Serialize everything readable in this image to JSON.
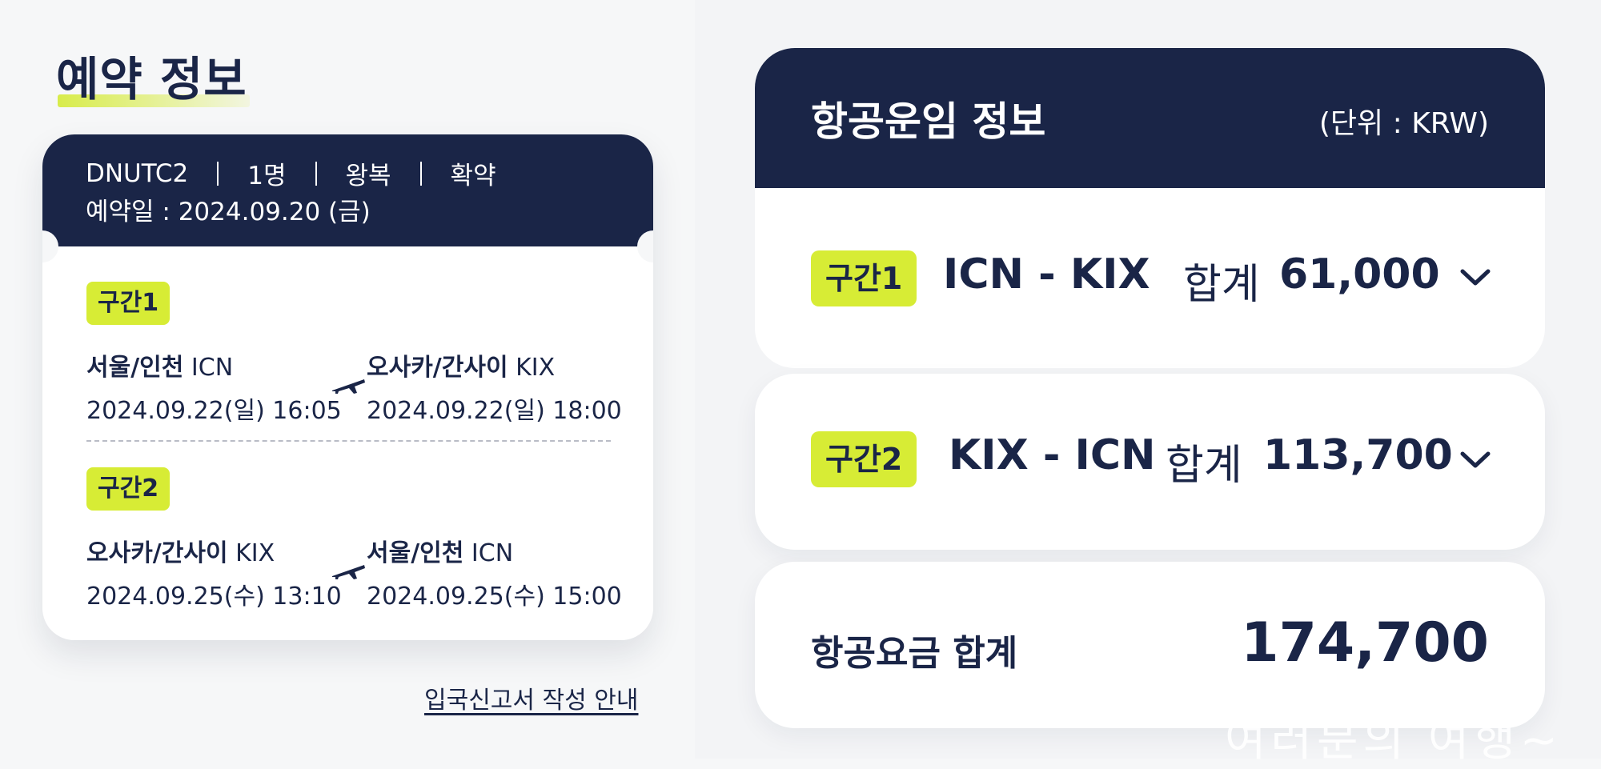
{
  "reservation": {
    "title": "예약 정보",
    "code": "DNUTC2",
    "passengers": "1명",
    "trip_type": "왕복",
    "status": "확약",
    "booked_date": "예약일 : 2024.09.20 (금)",
    "segments": [
      {
        "label": "구간1",
        "from_city": "서울/인천",
        "from_code": "ICN",
        "from_datetime": "2024.09.22(일) 16:05",
        "to_city": "오사카/간사이",
        "to_code": "KIX",
        "to_datetime": "2024.09.22(일) 18:00"
      },
      {
        "label": "구간2",
        "from_city": "오사카/간사이",
        "from_code": "KIX",
        "from_datetime": "2024.09.25(수) 13:10",
        "to_city": "서울/인천",
        "to_code": "ICN",
        "to_datetime": "2024.09.25(수) 15:00"
      }
    ],
    "immigration_link": "입국신고서 작성 안내"
  },
  "fare": {
    "title": "항공운임 정보",
    "unit": "(단위 : KRW)",
    "segments": [
      {
        "label": "구간1",
        "route": "ICN - KIX",
        "sum_label": "합계",
        "sum_value": "61,000"
      },
      {
        "label": "구간2",
        "route": "KIX - ICN",
        "sum_label": "합계",
        "sum_value": "113,700"
      }
    ],
    "total_label": "항공요금 합계",
    "total_value": "174,700"
  },
  "watermark": "여러분의 여행~",
  "colors": {
    "navy": "#1a2547",
    "lime": "#d7ec35",
    "background": "#f6f7f8"
  }
}
